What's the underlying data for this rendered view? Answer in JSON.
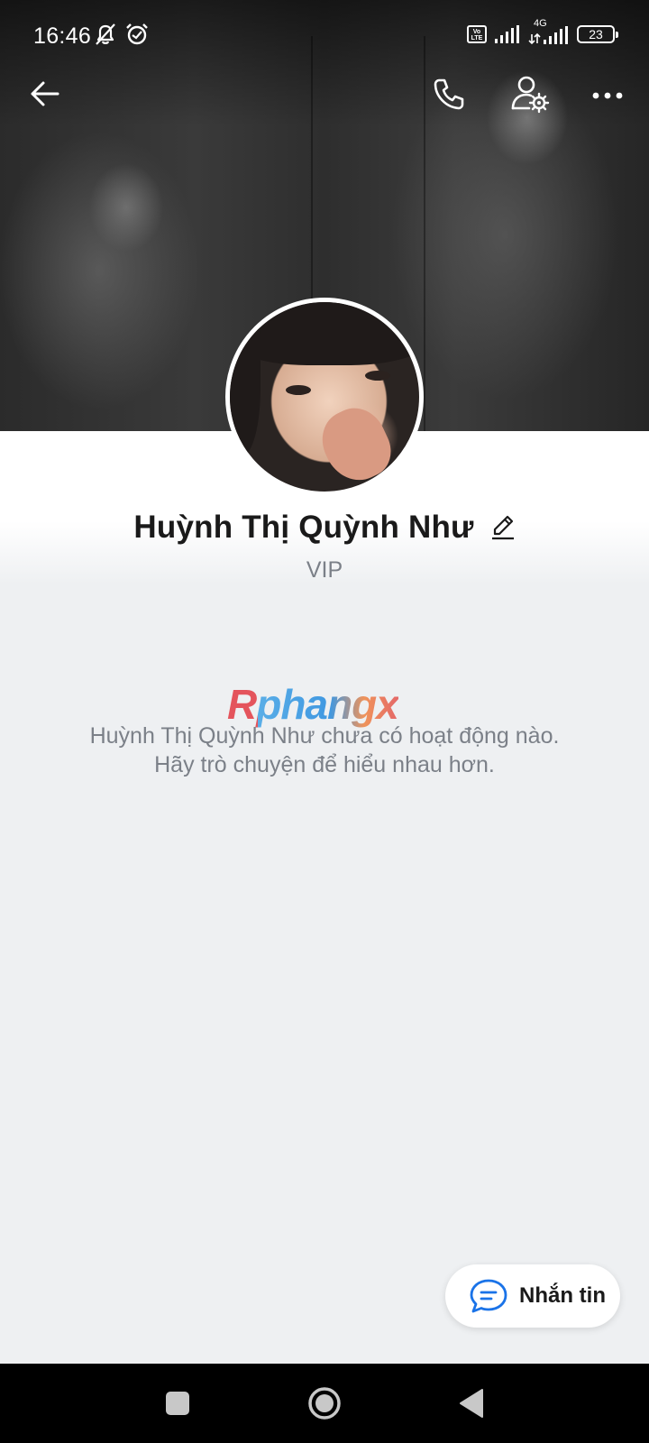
{
  "status_bar": {
    "time": "16:46",
    "network": "4G",
    "volte": "Vo LTE",
    "battery": "23"
  },
  "icons": {
    "back": "arrow-left-icon",
    "call": "phone-icon",
    "settings": "user-settings-icon",
    "more": "more-dots-icon",
    "edit": "pencil-icon",
    "message": "chat-bubble-icon"
  },
  "profile": {
    "name": "Huỳnh Thị Quỳnh Như",
    "subtitle": "VIP"
  },
  "watermark": "Rphangx",
  "empty_state": {
    "line1": "Huỳnh Thị Quỳnh Như chưa có hoạt động nào.",
    "line2": "Hãy trò chuyện để hiểu nhau hơn."
  },
  "message_button": {
    "label": "Nhắn tin"
  },
  "colors": {
    "accent": "#1a73e8",
    "text_primary": "#1a1a1a",
    "text_secondary": "#7b8088",
    "background": "#eef0f2"
  }
}
